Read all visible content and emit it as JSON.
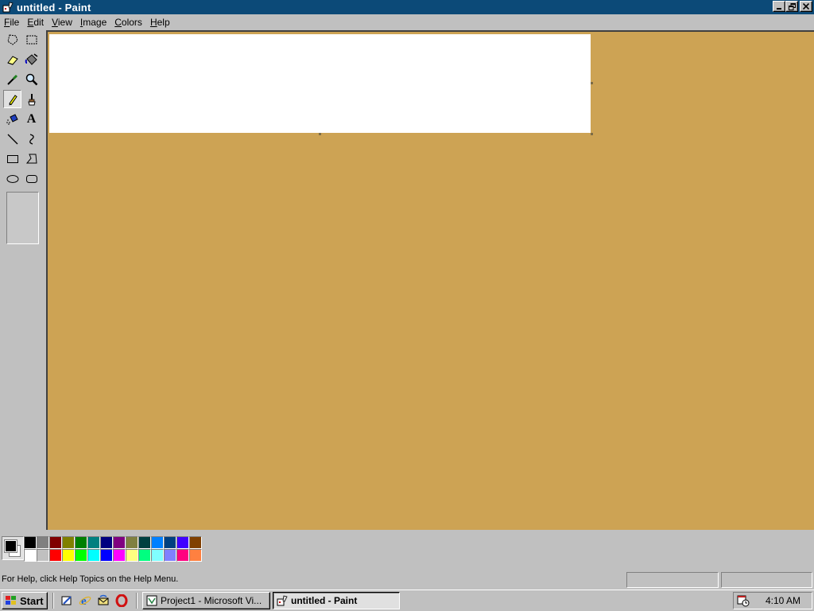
{
  "window": {
    "title": "untitled - Paint",
    "controls": {
      "minimize": "_",
      "restore": "❐",
      "close": "✕"
    }
  },
  "menu": [
    {
      "label": "File",
      "accel": "F"
    },
    {
      "label": "Edit",
      "accel": "E"
    },
    {
      "label": "View",
      "accel": "V"
    },
    {
      "label": "Image",
      "accel": "I"
    },
    {
      "label": "Colors",
      "accel": "C"
    },
    {
      "label": "Help",
      "accel": "H"
    }
  ],
  "tools": [
    {
      "icon": "free-form-select-icon"
    },
    {
      "icon": "select-icon"
    },
    {
      "icon": "eraser-icon"
    },
    {
      "icon": "fill-icon"
    },
    {
      "icon": "pick-color-icon"
    },
    {
      "icon": "magnifier-icon"
    },
    {
      "icon": "pencil-icon",
      "selected": true
    },
    {
      "icon": "brush-icon"
    },
    {
      "icon": "airbrush-icon"
    },
    {
      "icon": "text-icon",
      "glyph": "A"
    },
    {
      "icon": "line-icon"
    },
    {
      "icon": "curve-icon"
    },
    {
      "icon": "rectangle-icon"
    },
    {
      "icon": "polygon-icon"
    },
    {
      "icon": "ellipse-icon"
    },
    {
      "icon": "rounded-rectangle-icon"
    }
  ],
  "colors": {
    "workspace_bg": "#cda354",
    "canvas_bg": "#ffffff",
    "titlebar": "#0c4a78",
    "foreground": "#000000",
    "background": "#ffffff",
    "palette_row1": [
      "#000000",
      "#808080",
      "#800000",
      "#808000",
      "#008000",
      "#008080",
      "#000080",
      "#800080",
      "#808040",
      "#004040",
      "#0080ff",
      "#004080",
      "#4000ff",
      "#804000"
    ],
    "palette_row2": [
      "#ffffff",
      "#c0c0c0",
      "#ff0000",
      "#ffff00",
      "#00ff00",
      "#00ffff",
      "#0000ff",
      "#ff00ff",
      "#ffff80",
      "#00ff80",
      "#80ffff",
      "#8080ff",
      "#ff0080",
      "#ff8040"
    ]
  },
  "status": {
    "help_text": "For Help, click Help Topics on the Help Menu.",
    "position": "",
    "size": ""
  },
  "taskbar": {
    "start_label": "Start",
    "quick_launch": [
      "show-desktop-icon",
      "internet-explorer-icon",
      "outlook-express-icon",
      "opera-icon"
    ],
    "tasks": [
      {
        "label": "Project1 - Microsoft Vi...",
        "icon": "visual-basic-icon",
        "active": false
      },
      {
        "label": "untitled - Paint",
        "icon": "paint-icon",
        "active": true
      }
    ],
    "tray_icon": "scheduler-icon",
    "clock": "4:10 AM"
  }
}
